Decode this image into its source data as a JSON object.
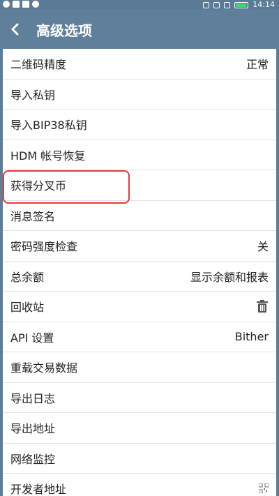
{
  "status_bar": {
    "time": "14:14",
    "icons": [
      "sync-icon",
      "usb-icon",
      "notification-icon",
      "mute-icon",
      "signal-icon",
      "wifi-icon",
      "battery-icon"
    ]
  },
  "header": {
    "title": "高级选项",
    "back_icon": "chevron-left-icon"
  },
  "settings": {
    "items": [
      {
        "label": "二维码精度",
        "value": "正常"
      },
      {
        "label": "导入私钥",
        "value": ""
      },
      {
        "label": "导入BIP38私钥",
        "value": ""
      },
      {
        "label": "HDM 帐号恢复",
        "value": ""
      },
      {
        "label": "获得分叉币",
        "value": ""
      },
      {
        "label": "消息签名",
        "value": ""
      },
      {
        "label": "密码强度检查",
        "value": "关"
      },
      {
        "label": "总余额",
        "value": "显示余额和报表"
      },
      {
        "label": "回收站",
        "value": "",
        "icon": "trash-icon"
      },
      {
        "label": "API 设置",
        "value": "Bither"
      },
      {
        "label": "重载交易数据",
        "value": ""
      },
      {
        "label": "导出日志",
        "value": ""
      },
      {
        "label": "导出地址",
        "value": ""
      },
      {
        "label": "网络监控",
        "value": ""
      },
      {
        "label": "开发者地址",
        "value": "",
        "icon": "qr-code-icon"
      }
    ]
  },
  "colors": {
    "header_bg": "#5f7f9b",
    "status_bg": "#5b7a95",
    "highlight_border": "#e53935",
    "battery_fill": "#3bd96b"
  }
}
